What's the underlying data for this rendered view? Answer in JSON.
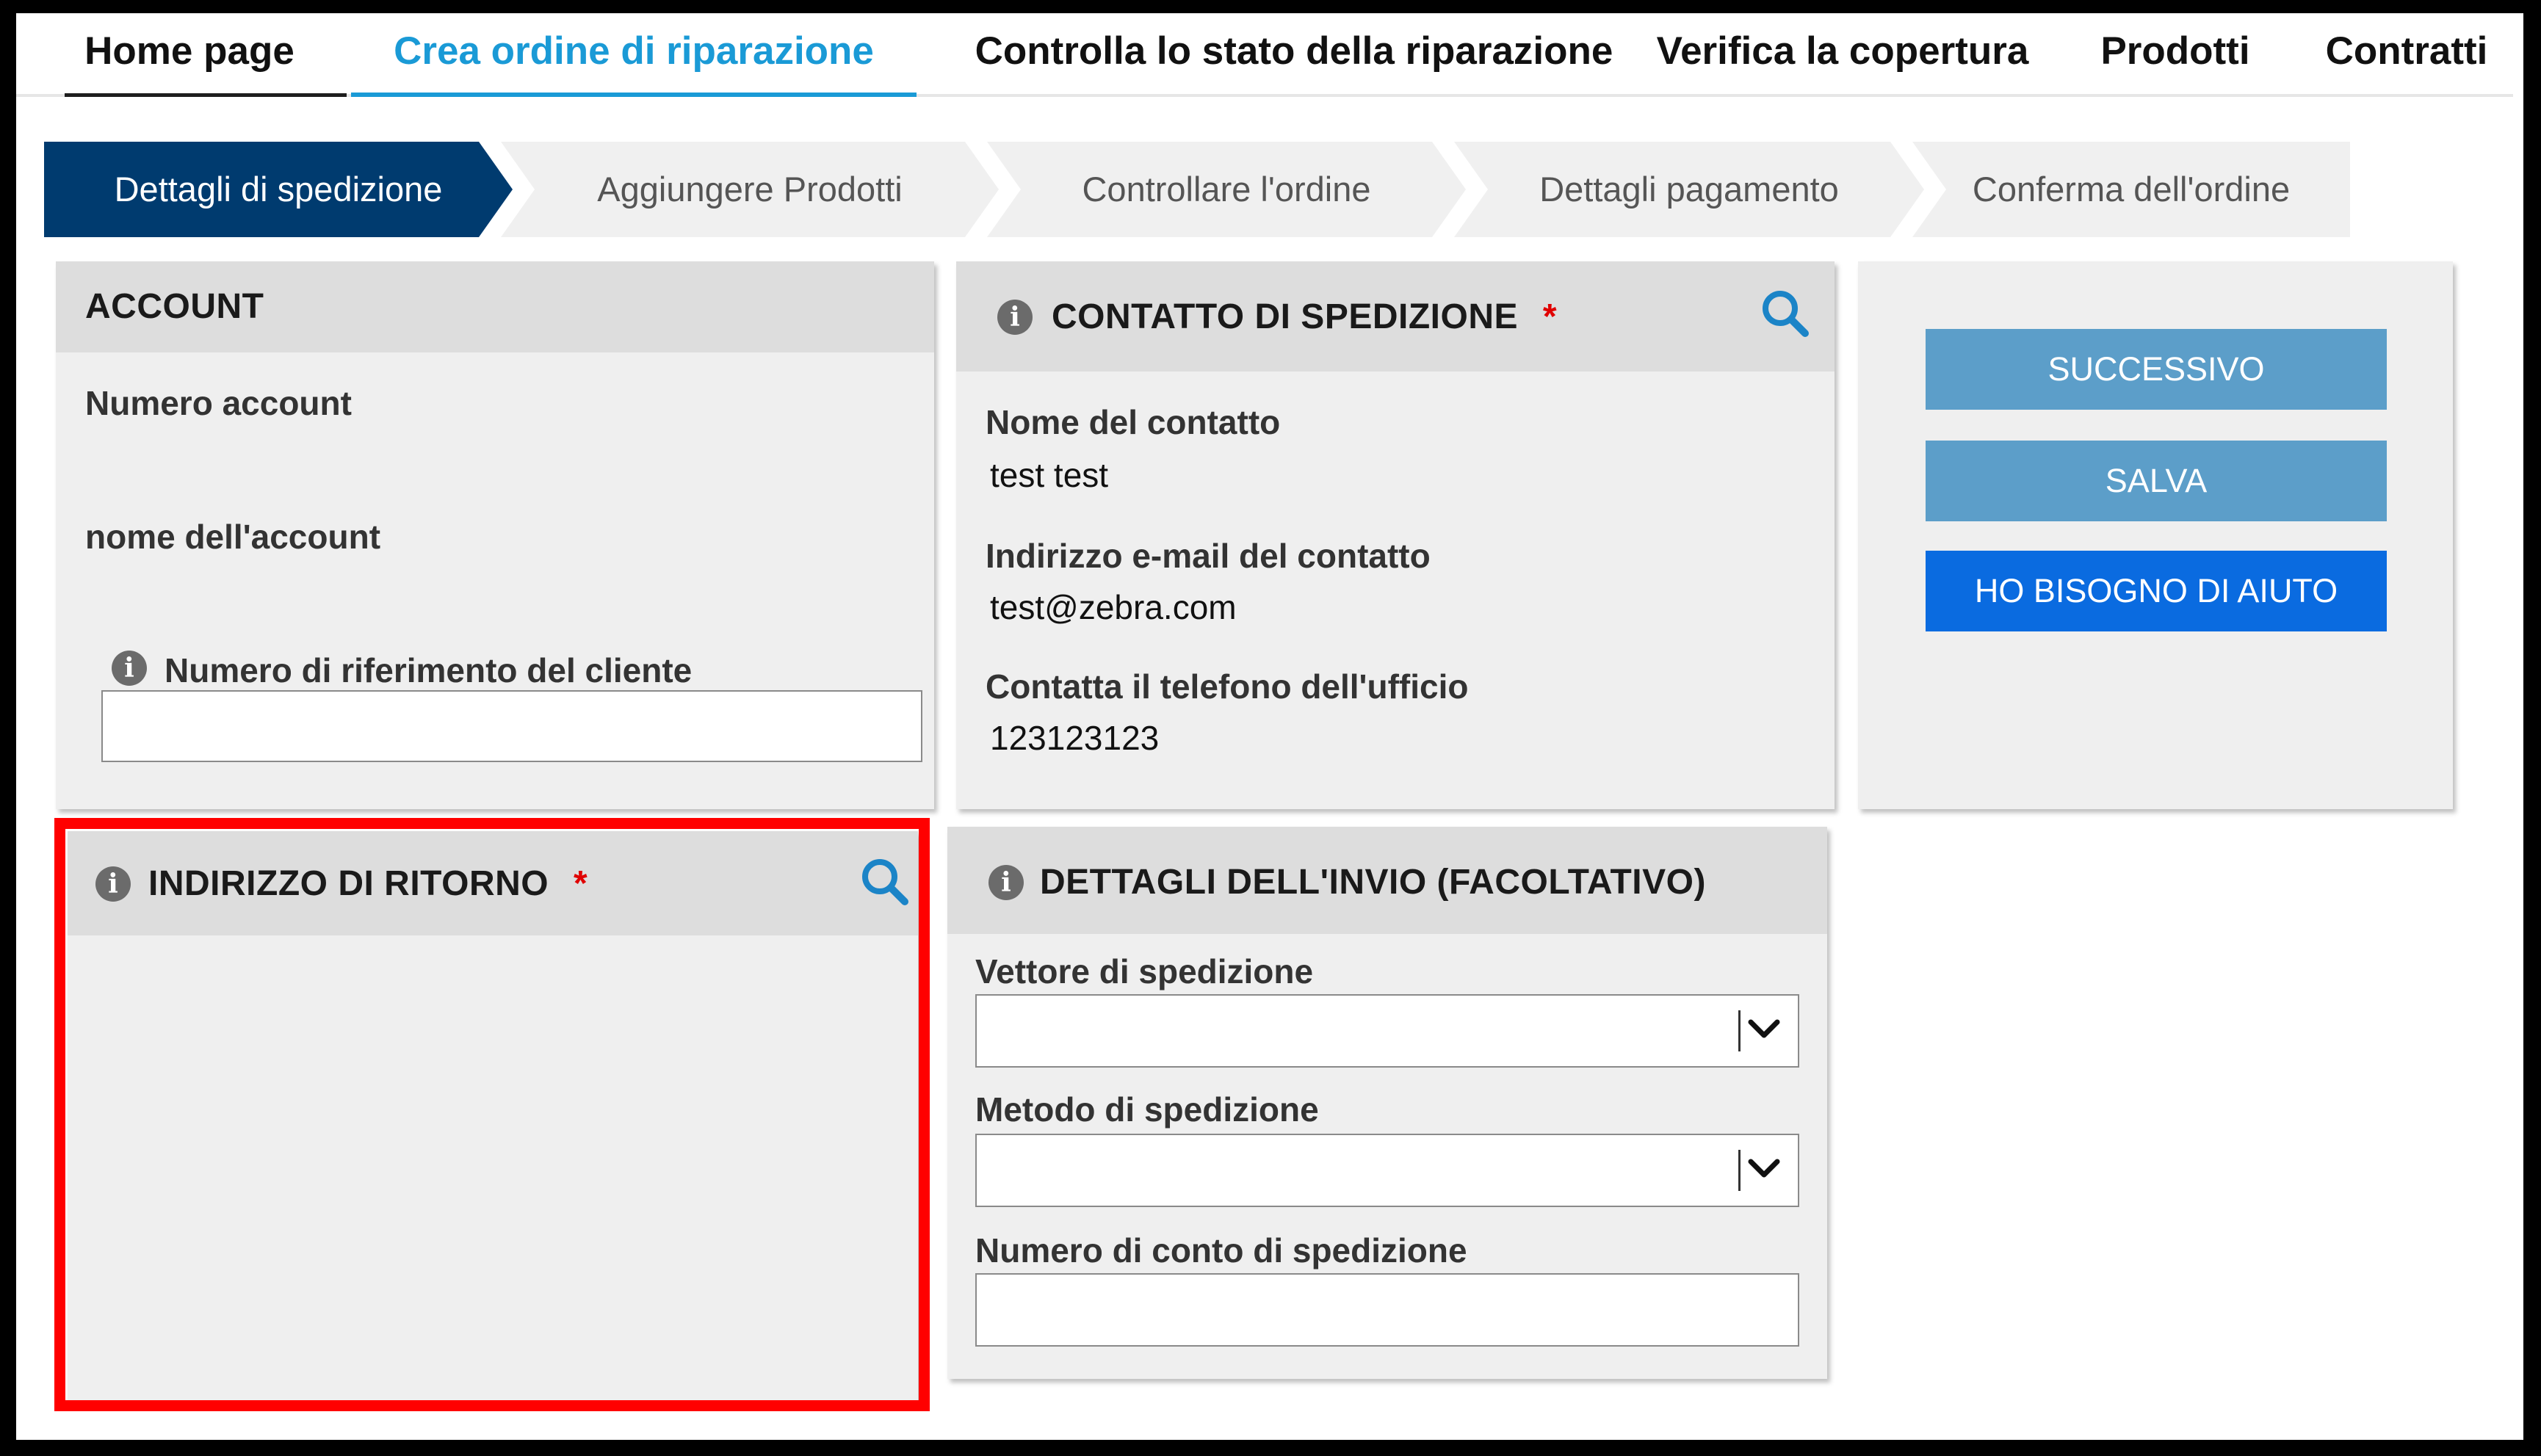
{
  "nav": {
    "items": [
      {
        "label": "Home page"
      },
      {
        "label": "Crea ordine di riparazione"
      },
      {
        "label": "Controlla lo stato della riparazione"
      },
      {
        "label": "Verifica la copertura"
      },
      {
        "label": "Prodotti"
      },
      {
        "label": "Contratti"
      }
    ],
    "active_index": 1,
    "active_color": "#1a9ad6"
  },
  "stepper": {
    "steps": [
      {
        "label": "Dettagli di spedizione"
      },
      {
        "label": "Aggiungere Prodotti"
      },
      {
        "label": "Controllare l'ordine"
      },
      {
        "label": "Dettagli pagamento"
      },
      {
        "label": "Conferma dell'ordine"
      }
    ],
    "active_index": 0,
    "active_color": "#003b6f"
  },
  "account": {
    "title": "ACCOUNT",
    "account_number_label": "Numero account",
    "account_number_value": "",
    "account_name_label": "nome dell'account",
    "account_name_value": "",
    "customer_ref_label": "Numero di riferimento del cliente",
    "customer_ref_value": ""
  },
  "contact": {
    "title": "CONTATTO DI SPEDIZIONE",
    "required_mark": "*",
    "name_label": "Nome del contatto",
    "name_value": "test test",
    "email_label": "Indirizzo e-mail del contatto",
    "email_value": "test@zebra.com",
    "phone_label": "Contatta il telefono dell'ufficio",
    "phone_value": "123123123"
  },
  "actions": {
    "next_label": "SUCCESSIVO",
    "save_label": "SALVA",
    "help_label": "HO BISOGNO DI AIUTO",
    "secondary_color": "#5c9ec9",
    "primary_color": "#0a6be0"
  },
  "return_address": {
    "title": "INDIRIZZO DI RITORNO",
    "required_mark": "*",
    "highlight_color": "#ff0000"
  },
  "shipping_details": {
    "title": "DETTAGLI DELL'INVIO (FACOLTATIVO)",
    "carrier_label": "Vettore di spedizione",
    "carrier_value": "",
    "method_label": "Metodo di spedizione",
    "method_value": "",
    "account_number_label": "Numero di conto di spedizione",
    "account_number_value": ""
  },
  "icons": {
    "info": "info-icon",
    "search": "search-icon",
    "dropdown": "chevron-down-icon"
  }
}
